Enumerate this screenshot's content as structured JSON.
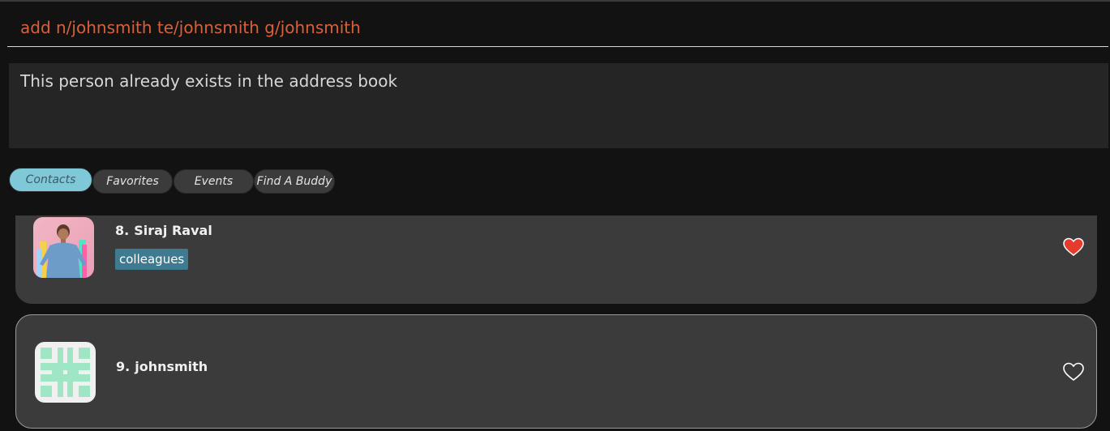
{
  "command_box": {
    "value": "add n/johnsmith te/johnsmith g/johnsmith"
  },
  "result_display": {
    "text": "This person already exists in the address book"
  },
  "tabs": [
    {
      "label": "Contacts",
      "active": true
    },
    {
      "label": "Favorites",
      "active": false
    },
    {
      "label": "Events",
      "active": false
    },
    {
      "label": "Find A Buddy",
      "active": false
    }
  ],
  "contacts": [
    {
      "index": "8.",
      "name": "Siraj Raval",
      "tags": [
        "colleagues"
      ],
      "favorite": true,
      "avatar_icon": "photo-avatar"
    },
    {
      "index": "9.",
      "name": "johnsmith",
      "tags": [],
      "favorite": false,
      "avatar_icon": "identicon-avatar"
    }
  ],
  "colors": {
    "command_text": "#d8613c",
    "active_tab": "#7ec8d8",
    "tag_bg": "#3e7b91",
    "heart_filled": "#e53c2e",
    "identicon": "#9ee6c4"
  }
}
